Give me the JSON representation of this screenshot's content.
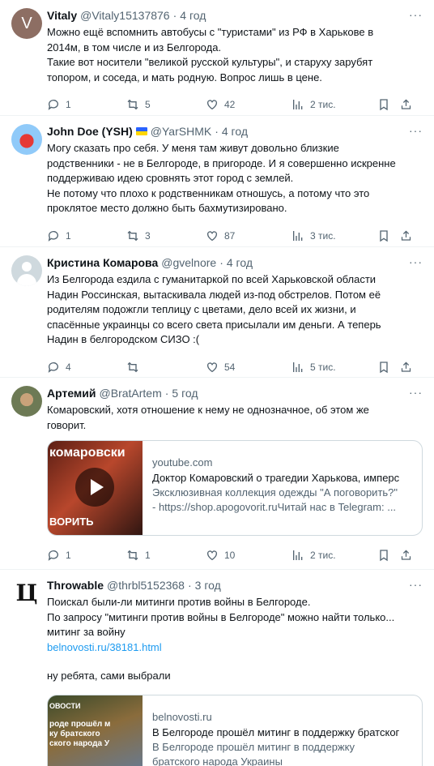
{
  "tweets": [
    {
      "name": "Vitaly",
      "handle": "@Vitaly15137876",
      "time": "4 год",
      "avatar_letter": "V",
      "text": "Можно ещё вспомнить автобусы с \"туристами\" из РФ в Харькове в\n2014м, в том числе и из Белгорода.\nТакие вот носители \"великой русской культуры\", и старуху зарубят\nтопором, и соседа, и мать родную. Вопрос лишь в цене.",
      "replies": "1",
      "reposts": "5",
      "likes": "42",
      "views": "2 тис."
    },
    {
      "name": "John Doe (YSH)",
      "handle": "@YarSHMK",
      "time": "4 год",
      "text": "Могу сказать про себя. У меня там живут довольно близкие\nродственники - не в Белгороде, в пригороде. И я совершенно искренне\nподдерживаю идею сровнять этот город с землей.\nНе потому что плохо к родственникам отношусь, а потому что это\nпроклятое место должно быть бахмутизировано.",
      "replies": "1",
      "reposts": "3",
      "likes": "87",
      "views": "3 тис."
    },
    {
      "name": "Кристина Комарова",
      "handle": "@gvelnore",
      "time": "4 год",
      "text": "Из Белгорода ездила с гуманитаркой по всей Харьковской области\nНадин Россинская, вытаскивала людей из-под обстрелов. Потом её\nродителям подожгли теплицу с цветами, дело всей их жизни, и\nспасённые украинцы со всего света присылали им деньги. А теперь\nНадин в белгородском СИЗО :(",
      "replies": "4",
      "reposts": "",
      "likes": "54",
      "views": "5 тис."
    },
    {
      "name": "Артемий",
      "handle": "@BratArtem",
      "time": "5 год",
      "text": "Комаровский, хотя отношение к нему не однозначное, об этом же\nговорит.",
      "card": {
        "thumb_text_top": "комаровски",
        "thumb_text_bottom": "ВОРИТЬ",
        "domain": "youtube.com",
        "title": "Доктор Комаровский о трагедии Харькова, имперс",
        "desc": "Эксклюзивная коллекция одежды \"А поговорить?\"\n- https://shop.apogovorit.ruЧитай нас в Telegram: ..."
      },
      "replies": "1",
      "reposts": "1",
      "likes": "10",
      "views": "2 тис."
    },
    {
      "name": "Throwable",
      "handle": "@thrbl5152368",
      "time": "3 год",
      "avatar_letter": "Ц",
      "text": "Поискал были-ли митинги против войны в Белгороде.\nПо запросу \"митинги против войны в Белгороде\" можно найти только...\nмитинг за войну",
      "link": "belnovosti.ru/38181.html",
      "text2": "ну ребята, сами выбрали",
      "card": {
        "thumb_text_top": "ОВОСТИ",
        "thumb_text_bottom": "роде прошёл м\nку братского\nского народа У",
        "domain": "belnovosti.ru",
        "title": "В Белгороде прошёл митинг в поддержку братског",
        "desc": "В Белгороде прошёл митинг в поддержку\nбратского народа Украины"
      }
    }
  ],
  "more_glyph": "···",
  "dot": "·"
}
